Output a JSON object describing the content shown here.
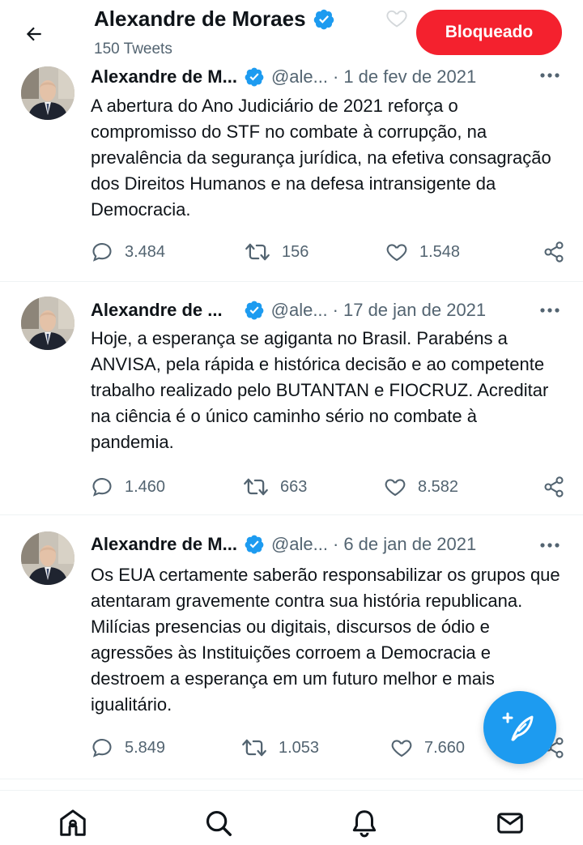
{
  "header": {
    "title": "Alexandre de Moraes",
    "subtitle": "150 Tweets",
    "blocked_label": "Bloqueado"
  },
  "tweets": [
    {
      "name": "Alexandre de M...",
      "handle": "@ale...",
      "separator": "·",
      "date": "1 de fev de 2021",
      "text": "A abertura do Ano Judiciário de 2021 reforça o compromisso do STF no combate à corrupção, na prevalência da segurança jurídica, na efetiva consagração dos Direitos Humanos e na defesa intransigente da Democracia.",
      "replies": "3.484",
      "retweets": "156",
      "likes": "1.548"
    },
    {
      "name": "Alexandre de ...",
      "handle": "@ale...",
      "separator": "·",
      "date": "17 de jan de 2021",
      "text": "Hoje, a esperança se agiganta no Brasil. Parabéns a ANVISA, pela rápida e histórica decisão e ao competente trabalho realizado pelo BUTANTAN e FIOCRUZ. Acreditar na ciência é o único caminho sério no combate à pandemia.",
      "replies": "1.460",
      "retweets": "663",
      "likes": "8.582"
    },
    {
      "name": "Alexandre de M...",
      "handle": "@ale...",
      "separator": "·",
      "date": "6 de jan de 2021",
      "text": "Os EUA certamente saberão responsabilizar os grupos que atentaram gravemente contra sua história republicana. Milícias presencias ou digitais, discursos de ódio e agressões às Instituições corroem a Democracia e destroem a esperança em um futuro melhor e mais igualitário.",
      "replies": "5.849",
      "retweets": "1.053",
      "likes": "7.660"
    }
  ],
  "icons": {
    "back": "arrow-left-icon",
    "verified": "verified-badge-icon",
    "more": "more-horizontal-icon",
    "reply": "reply-icon",
    "retweet": "retweet-icon",
    "like": "heart-icon",
    "share": "share-icon",
    "compose": "compose-icon",
    "home": "home-icon",
    "search": "search-icon",
    "notifications": "bell-icon",
    "messages": "mail-icon"
  },
  "colors": {
    "accent": "#1d9bf0",
    "blocked": "#f4212e",
    "muted_text": "#536471",
    "text": "#0f1419"
  }
}
